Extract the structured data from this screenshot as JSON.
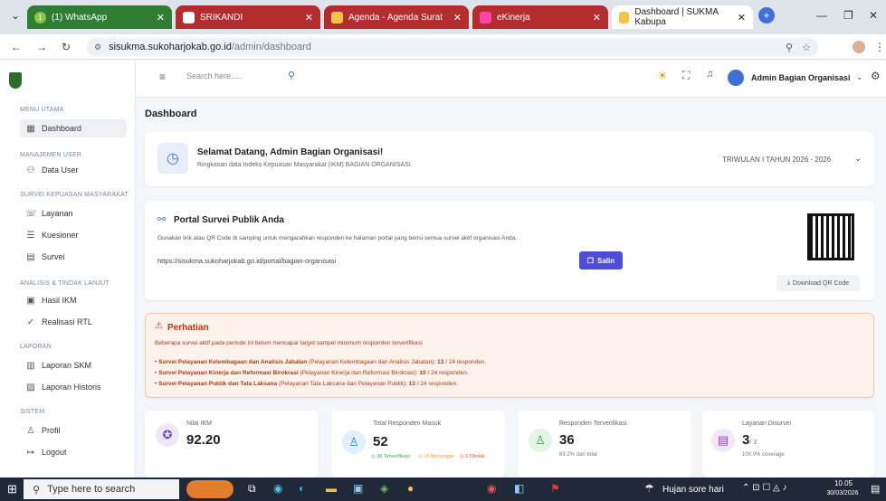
{
  "browser": {
    "tabs": [
      {
        "label": "(1) WhatsApp",
        "badge": "1",
        "color": "#2e7d32"
      },
      {
        "label": "SRIKANDI",
        "color": "#b32d2e"
      },
      {
        "label": "Agenda - Agenda Surat",
        "color": "#b32d2e"
      },
      {
        "label": "eKinerja",
        "color": "#b32d2e"
      },
      {
        "label": "Dashboard | SUKMA Kabupa",
        "color": "#ffffff"
      }
    ],
    "url_host": "sisukma.sukoharjokab.go.id",
    "url_path": "/admin/dashboard"
  },
  "sidebar": {
    "sections": [
      {
        "title": "MENU UTAMA",
        "items": [
          {
            "label": "Dashboard",
            "icon": "grid-icon",
            "active": true
          }
        ]
      },
      {
        "title": "MANAJEMEN USER",
        "items": [
          {
            "label": "Data User",
            "icon": "users-icon"
          }
        ]
      },
      {
        "title": "SURVEI KEPUASAN MASYARAKAT",
        "items": [
          {
            "label": "Layanan",
            "icon": "service-icon"
          },
          {
            "label": "Kuesioner",
            "icon": "list-icon"
          },
          {
            "label": "Survei",
            "icon": "clipboard-icon"
          }
        ]
      },
      {
        "title": "ANALISIS & TINDAK LANJUT",
        "items": [
          {
            "label": "Hasil IKM",
            "icon": "chart-icon"
          },
          {
            "label": "Realisasi RTL",
            "icon": "check-icon"
          }
        ]
      },
      {
        "title": "LAPORAN",
        "items": [
          {
            "label": "Laporan SKM",
            "icon": "report-icon"
          },
          {
            "label": "Laporan Historis",
            "icon": "history-icon"
          }
        ]
      },
      {
        "title": "SISTEM",
        "items": [
          {
            "label": "Profil",
            "icon": "user-icon"
          },
          {
            "label": "Logout",
            "icon": "logout-icon"
          }
        ]
      }
    ]
  },
  "topbar": {
    "search_placeholder": "Search here.....",
    "user_name": "Admin Bagian Organisasi"
  },
  "page_title": "Dashboard",
  "welcome": {
    "title": "Selamat Datang, Admin Bagian Organisasi!",
    "subtitle": "Ringkasan data Indeks Kepuasan Masyarakat (IKM) BAGIAN ORGANISASI.",
    "period": "TRIWULAN I TAHUN 2026 - 2026"
  },
  "portal": {
    "title": "Portal Survei Publik Anda",
    "desc": "Gunakan link atau QR Code di samping untuk mengarahkan responden ke halaman portal yang berisi semua survei aktif organisasi Anda.",
    "link": "https://sisukma.sukoharjokab.go.id/portal/bagian-organisasi",
    "copy_label": "Salin",
    "download_label": "Download QR Code"
  },
  "warning": {
    "title": "Perhatian",
    "desc": "Beberapa survei aktif pada periode ini belum mencapai target sampel minimum responden terverifikasi:",
    "items": [
      {
        "name": "Survei Pelayanan Kelembagaan dan Analisis Jabatan",
        "detail": "(Pelayanan Kelembagaan dan Analisis Jabatan):",
        "count": "13",
        "total": "/ 24 responden."
      },
      {
        "name": "Survei Pelayanan Kinerja dan Reformasi Birokrasi",
        "detail": "(Pelayanan Kinerja dan Reformasi Birokrasi):",
        "count": "10",
        "total": "/ 24 responden."
      },
      {
        "name": "Survei Pelayanan Publik dan Tata Laksana",
        "detail": "(Pelayanan Tata Laksana dan Pelayanan Publik):",
        "count": "13",
        "total": "/ 24 responden."
      }
    ]
  },
  "stats": [
    {
      "label": "Nilai IKM",
      "value": "92.20",
      "icon": "medal-icon",
      "color": "#6f42c1"
    },
    {
      "label": "Total Responden Masuk",
      "value": "52",
      "icon": "user-plus-icon",
      "color": "#1e88e5",
      "sub1": "36",
      "sub1_label": "Terverifikasi",
      "sub2": "16",
      "sub2_label": "Menunggu",
      "sub3": "0",
      "sub3_label": "Ditolak"
    },
    {
      "label": "Responden Terverifikasi",
      "value": "36",
      "icon": "user-check-icon",
      "color": "#43a047",
      "sub": "69.2% dari total"
    },
    {
      "label": "Layanan Disurvei",
      "value": "3",
      "value_suffix": "/ 3",
      "icon": "doc-icon",
      "color": "#8e44ad",
      "sub": "100.0% coverage"
    }
  ],
  "taskbar": {
    "search_placeholder": "Type here to search",
    "weather": "Hujan sore hari",
    "time": "10.05",
    "date": "30/03/2026"
  }
}
